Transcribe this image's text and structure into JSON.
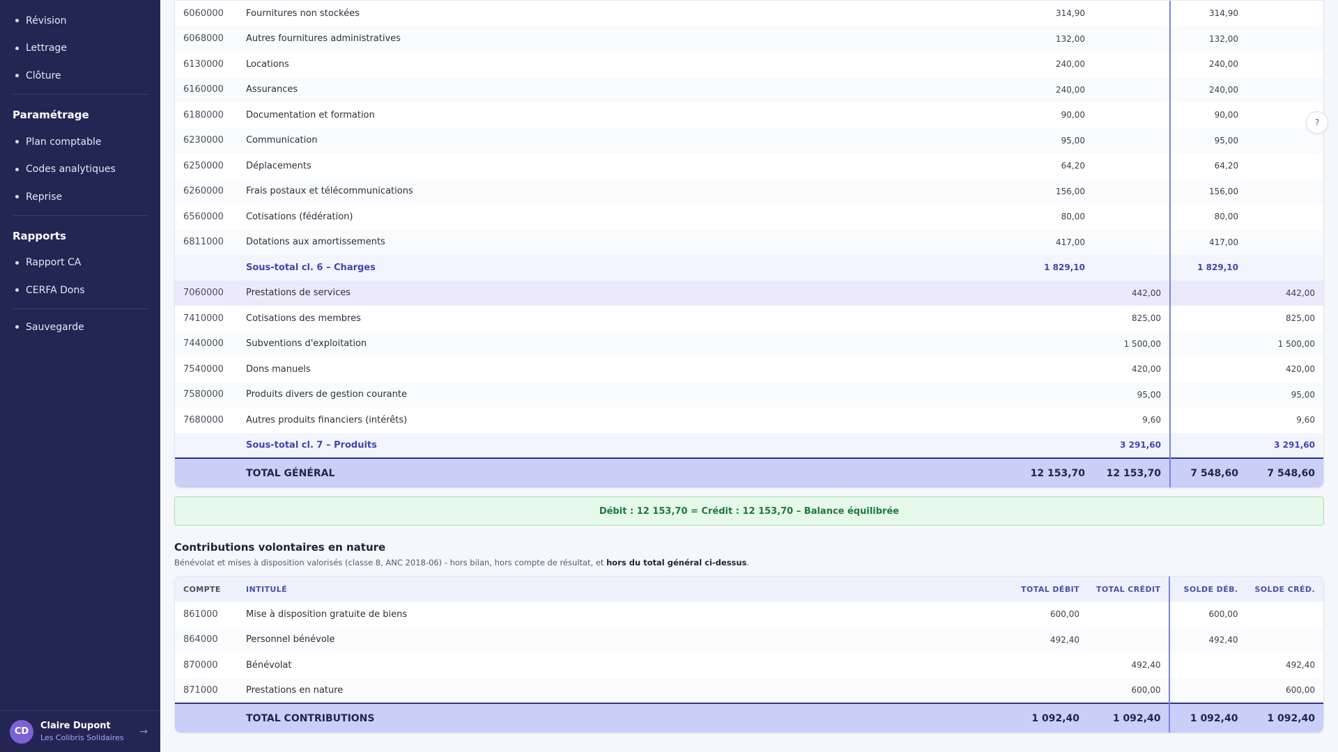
{
  "sidebar": {
    "top_items": [
      {
        "label": "Révision"
      },
      {
        "label": "Lettrage"
      },
      {
        "label": "Clôture"
      }
    ],
    "sections": [
      {
        "title": "Paramétrage",
        "items": [
          {
            "label": "Plan comptable"
          },
          {
            "label": "Codes analytiques"
          },
          {
            "label": "Reprise"
          }
        ]
      },
      {
        "title": "Rapports",
        "items": [
          {
            "label": "Rapport CA"
          },
          {
            "label": "CERFA Dons"
          }
        ]
      }
    ],
    "bottom_item": {
      "label": "Sauvegarde"
    },
    "user": {
      "initials": "CD",
      "name": "Claire Dupont",
      "org": "Les Colibris Solidaires",
      "logout_icon": "→"
    }
  },
  "help": {
    "label": "?"
  },
  "balance_table": {
    "rows": [
      {
        "code": "6060000",
        "label": "Fournitures non stockées",
        "debit": "314,90",
        "credit": "",
        "solde_deb": "314,90",
        "solde_cred": ""
      },
      {
        "code": "6068000",
        "label": "Autres fournitures administratives",
        "debit": "132,00",
        "credit": "",
        "solde_deb": "132,00",
        "solde_cred": ""
      },
      {
        "code": "6130000",
        "label": "Locations",
        "debit": "240,00",
        "credit": "",
        "solde_deb": "240,00",
        "solde_cred": ""
      },
      {
        "code": "6160000",
        "label": "Assurances",
        "debit": "240,00",
        "credit": "",
        "solde_deb": "240,00",
        "solde_cred": ""
      },
      {
        "code": "6180000",
        "label": "Documentation et formation",
        "debit": "90,00",
        "credit": "",
        "solde_deb": "90,00",
        "solde_cred": ""
      },
      {
        "code": "6230000",
        "label": "Communication",
        "debit": "95,00",
        "credit": "",
        "solde_deb": "95,00",
        "solde_cred": ""
      },
      {
        "code": "6250000",
        "label": "Déplacements",
        "debit": "64,20",
        "credit": "",
        "solde_deb": "64,20",
        "solde_cred": ""
      },
      {
        "code": "6260000",
        "label": "Frais postaux et télécommunications",
        "debit": "156,00",
        "credit": "",
        "solde_deb": "156,00",
        "solde_cred": ""
      },
      {
        "code": "6560000",
        "label": "Cotisations (fédération)",
        "debit": "80,00",
        "credit": "",
        "solde_deb": "80,00",
        "solde_cred": ""
      },
      {
        "code": "6811000",
        "label": "Dotations aux amortissements",
        "debit": "417,00",
        "credit": "",
        "solde_deb": "417,00",
        "solde_cred": ""
      },
      {
        "type": "sub",
        "code": "",
        "label": "Sous-total cl. 6 – Charges",
        "debit": "1 829,10",
        "credit": "",
        "solde_deb": "1 829,10",
        "solde_cred": ""
      },
      {
        "type": "hl",
        "code": "7060000",
        "label": "Prestations de services",
        "debit": "",
        "credit": "442,00",
        "solde_deb": "",
        "solde_cred": "442,00"
      },
      {
        "code": "7410000",
        "label": "Cotisations des membres",
        "debit": "",
        "credit": "825,00",
        "solde_deb": "",
        "solde_cred": "825,00"
      },
      {
        "code": "7440000",
        "label": "Subventions d'exploitation",
        "debit": "",
        "credit": "1 500,00",
        "solde_deb": "",
        "solde_cred": "1 500,00"
      },
      {
        "code": "7540000",
        "label": "Dons manuels",
        "debit": "",
        "credit": "420,00",
        "solde_deb": "",
        "solde_cred": "420,00"
      },
      {
        "code": "7580000",
        "label": "Produits divers de gestion courante",
        "debit": "",
        "credit": "95,00",
        "solde_deb": "",
        "solde_cred": "95,00"
      },
      {
        "code": "7680000",
        "label": "Autres produits financiers (intérêts)",
        "debit": "",
        "credit": "9,60",
        "solde_deb": "",
        "solde_cred": "9,60"
      },
      {
        "type": "sub",
        "code": "",
        "label": "Sous-total cl. 7 – Produits",
        "debit": "",
        "credit": "3 291,60",
        "solde_deb": "",
        "solde_cred": "3 291,60"
      }
    ],
    "total": {
      "label": "TOTAL GÉNÉRAL",
      "debit": "12 153,70",
      "credit": "12 153,70",
      "solde_deb": "7 548,60",
      "solde_cred": "7 548,60"
    }
  },
  "balance_check": "Débit : 12 153,70 = Crédit : 12 153,70 – Balance équilibrée",
  "contributions": {
    "title": "Contributions volontaires en nature",
    "desc_prefix": "Bénévolat et mises à disposition valorisés (classe 8, ANC 2018-06) - hors bilan, hors compte de résultat, et ",
    "desc_bold": "hors du total général ci-dessus",
    "desc_suffix": ".",
    "headers": {
      "code": "COMPTE",
      "label": "INTITULÉ",
      "debit": "TOTAL DÉBIT",
      "credit": "TOTAL CRÉDIT",
      "solde_deb": "SOLDE DÉB.",
      "solde_cred": "SOLDE CRÉD."
    },
    "rows": [
      {
        "code": "861000",
        "label": "Mise à disposition gratuite de biens",
        "debit": "600,00",
        "credit": "",
        "solde_deb": "600,00",
        "solde_cred": ""
      },
      {
        "code": "864000",
        "label": "Personnel bénévole",
        "debit": "492,40",
        "credit": "",
        "solde_deb": "492,40",
        "solde_cred": ""
      },
      {
        "code": "870000",
        "label": "Bénévolat",
        "debit": "",
        "credit": "492,40",
        "solde_deb": "",
        "solde_cred": "492,40"
      },
      {
        "code": "871000",
        "label": "Prestations en nature",
        "debit": "",
        "credit": "600,00",
        "solde_deb": "",
        "solde_cred": "600,00"
      }
    ],
    "total": {
      "label": "TOTAL CONTRIBUTIONS",
      "debit": "1 092,40",
      "credit": "1 092,40",
      "solde_deb": "1 092,40",
      "solde_cred": "1 092,40"
    }
  }
}
